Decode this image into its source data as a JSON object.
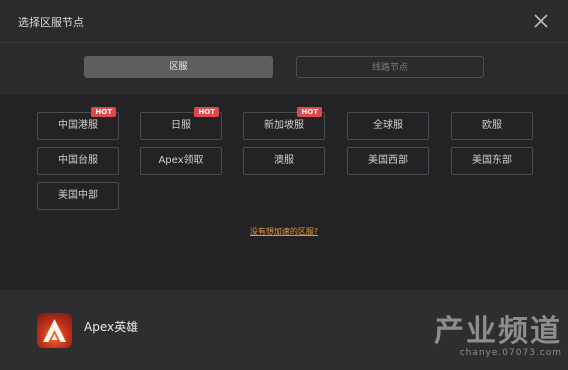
{
  "window": {
    "title": "选择区服节点",
    "close_icon": "close-icon"
  },
  "tabs": [
    {
      "label": "区服",
      "active": true
    },
    {
      "label": "线路节点",
      "active": false
    }
  ],
  "servers": [
    {
      "label": "中国港服",
      "hot": true
    },
    {
      "label": "日服",
      "hot": true
    },
    {
      "label": "新加坡服",
      "hot": true
    },
    {
      "label": "全球服",
      "hot": false
    },
    {
      "label": "欧服",
      "hot": false
    },
    {
      "label": "中国台服",
      "hot": false
    },
    {
      "label": "Apex领取",
      "hot": false
    },
    {
      "label": "澳服",
      "hot": false
    },
    {
      "label": "美国西部",
      "hot": false
    },
    {
      "label": "美国东部",
      "hot": false
    },
    {
      "label": "美国中部",
      "hot": false
    }
  ],
  "hot_badge": "HOT",
  "missing_link": "没有想加速的区服?",
  "footer": {
    "game_name": "Apex英雄",
    "game_icon": "apex-logo-icon"
  },
  "watermark": {
    "main": "产业频道",
    "sub": "chanye.07073.com"
  },
  "colors": {
    "accent_hot": "#e0494c",
    "link": "#e8953f",
    "bg": "#2b2b2e",
    "panel": "#232326"
  }
}
